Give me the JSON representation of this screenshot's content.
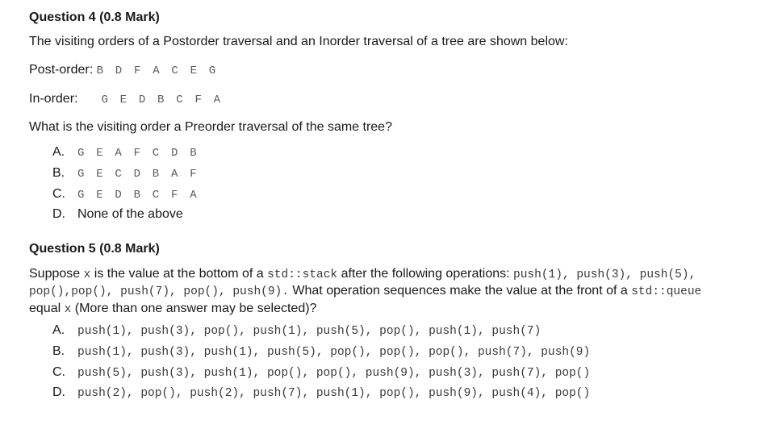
{
  "q4": {
    "title": "Question 4 (0.8 Mark)",
    "intro": "The visiting orders of a Postorder traversal and an Inorder traversal of a tree are shown below:",
    "postorder_label": "Post-order:",
    "postorder_value": "B D F A C E G",
    "inorder_label": "In-order:",
    "inorder_value": "G E D B C F A",
    "question": "What is the visiting order a Preorder traversal of the same tree?",
    "options": [
      {
        "letter": "A.",
        "text": "G E A F C D B",
        "mono": true
      },
      {
        "letter": "B.",
        "text": "G E C D B A F",
        "mono": true
      },
      {
        "letter": "C.",
        "text": "G E D B C F A",
        "mono": true
      },
      {
        "letter": "D.",
        "text": "None of the above",
        "mono": false
      }
    ]
  },
  "q5": {
    "title": "Question 5 (0.8 Mark)",
    "line1_pre": "Suppose ",
    "var_x": "x",
    "line1_mid": " is the value at the bottom of a ",
    "stack": "std::stack",
    "line1_post": " after the following operations: ",
    "ops1": "push(1), push(3), push(5),",
    "ops2": "pop(),pop(), push(7), pop(), push(9).",
    "line2_post": " What operation sequences make the value at the front of a ",
    "queue": "std::queue",
    "line3_pre": "equal ",
    "line3_post": " (More than one answer may be selected)?",
    "options": [
      {
        "letter": "A.",
        "text": "push(1), push(3), pop(), push(1), push(5), pop(), push(1), push(7)"
      },
      {
        "letter": "B.",
        "text": "push(1), push(3), push(1), push(5), pop(), pop(), pop(), push(7), push(9)"
      },
      {
        "letter": "C.",
        "text": "push(5), push(3), push(1), pop(), pop(), push(9), push(3), push(7), pop()"
      },
      {
        "letter": "D.",
        "text": "push(2), pop(), push(2), push(7), push(1), pop(), push(9), push(4), pop()"
      }
    ]
  }
}
